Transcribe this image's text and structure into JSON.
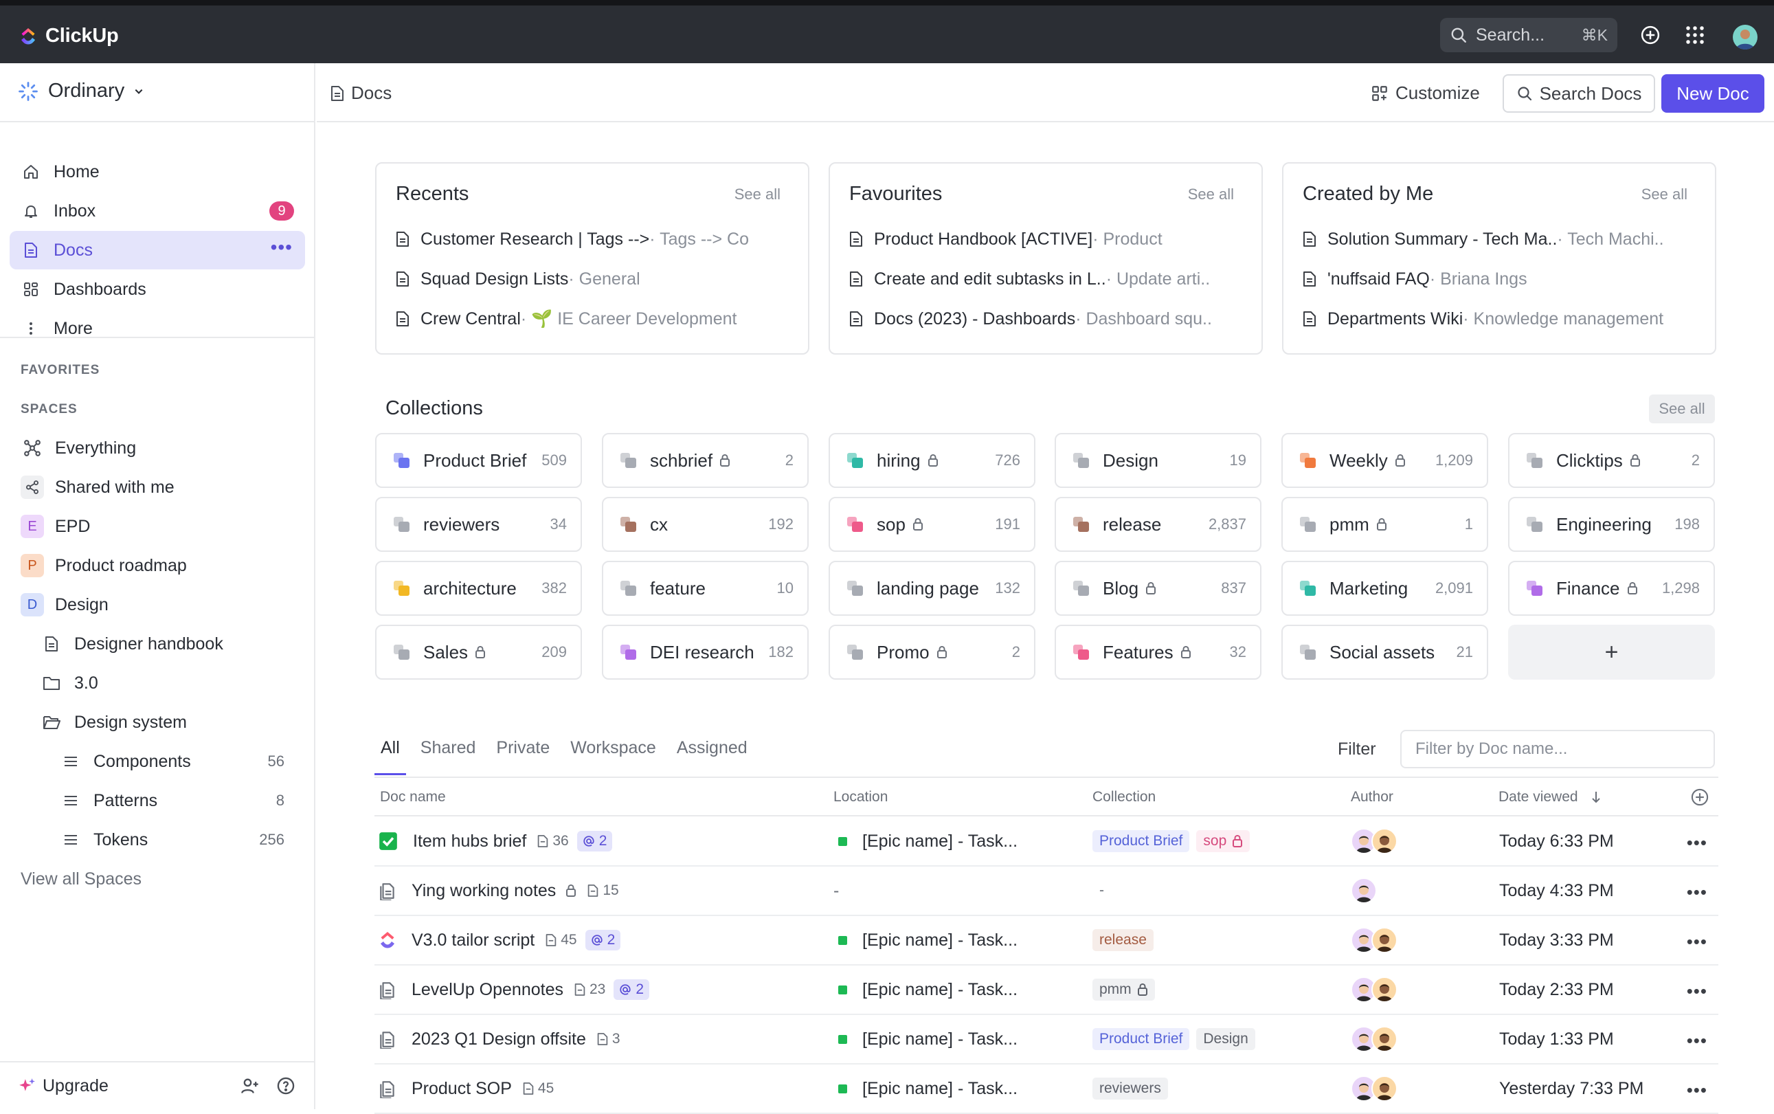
{
  "topbar": {
    "app_name": "ClickUp",
    "search_placeholder": "Search...",
    "search_shortcut": "⌘K"
  },
  "sidebar": {
    "workspace": "Ordinary",
    "nav": [
      {
        "label": "Home",
        "icon": "home-icon"
      },
      {
        "label": "Inbox",
        "icon": "bell-icon",
        "badge": "9"
      },
      {
        "label": "Docs",
        "icon": "doc-icon",
        "active": true
      },
      {
        "label": "Dashboards",
        "icon": "grid-icon"
      },
      {
        "label": "More",
        "icon": "more-vertical-icon"
      }
    ],
    "favorites_label": "FAVORITES",
    "spaces_label": "SPACES",
    "spaces": [
      {
        "label": "Everything",
        "icon": "everything-icon"
      },
      {
        "label": "Shared with me",
        "icon": "share-icon"
      },
      {
        "label": "EPD",
        "letter": "E",
        "color": "#e9d5f8",
        "fg": "#8a3fc7"
      },
      {
        "label": "Product roadmap",
        "letter": "P",
        "color": "#fbd8c2",
        "fg": "#c2531b"
      },
      {
        "label": "Design",
        "letter": "D",
        "color": "#d9e2fb",
        "fg": "#3a5bd0"
      }
    ],
    "tree": [
      {
        "label": "Designer handbook",
        "icon": "doc-icon"
      },
      {
        "label": "3.0",
        "icon": "folder-icon"
      },
      {
        "label": "Design system",
        "icon": "folder-open-icon"
      },
      {
        "label": "Components",
        "icon": "list-icon",
        "count": "56"
      },
      {
        "label": "Patterns",
        "icon": "list-icon",
        "count": "8"
      },
      {
        "label": "Tokens",
        "icon": "list-icon",
        "count": "256"
      }
    ],
    "view_all": "View all Spaces",
    "upgrade": "Upgrade"
  },
  "header": {
    "crumb": "Docs",
    "customize": "Customize",
    "search_docs": "Search Docs",
    "new_doc": "New Doc"
  },
  "cards": [
    {
      "title": "Recents",
      "see_all": "See all",
      "rows": [
        {
          "name": "Customer Research | Tags -->",
          "sub": " · Tags --> Co"
        },
        {
          "name": "Squad Design Lists",
          "sub": " · General"
        },
        {
          "name": "Crew Central",
          "sub": " · 🌱 IE Career Development"
        }
      ]
    },
    {
      "title": "Favourites",
      "see_all": "See all",
      "rows": [
        {
          "name": "Product Handbook [ACTIVE]",
          "sub": " · Product"
        },
        {
          "name": "Create and edit subtasks in L..",
          "sub": " · Update arti.."
        },
        {
          "name": "Docs (2023) - Dashboards",
          "sub": " · Dashboard squ.."
        }
      ]
    },
    {
      "title": "Created by Me",
      "see_all": "See all",
      "rows": [
        {
          "name": "Solution Summary - Tech Ma..",
          "sub": " · Tech Machi.."
        },
        {
          "name": "'nuffsaid FAQ",
          "sub": " · Briana Ings"
        },
        {
          "name": "Departments Wiki",
          "sub": " · Knowledge management"
        }
      ]
    }
  ],
  "collections": {
    "title": "Collections",
    "see_all": "See all",
    "items": [
      {
        "name": "Product Brief",
        "count": "509",
        "color": "#6b74f0",
        "lock": false
      },
      {
        "name": "schbrief",
        "count": "2",
        "color": "#a7abb3",
        "lock": true
      },
      {
        "name": "hiring",
        "count": "726",
        "color": "#2fb9a6",
        "lock": true
      },
      {
        "name": "Design",
        "count": "19",
        "color": "#a7abb3",
        "lock": false
      },
      {
        "name": "Weekly",
        "count": "1,209",
        "color": "#f07a3e",
        "lock": true
      },
      {
        "name": "Clicktips",
        "count": "2",
        "color": "#a7abb3",
        "lock": true
      },
      {
        "name": "reviewers",
        "count": "34",
        "color": "#a7abb3",
        "lock": false
      },
      {
        "name": "cx",
        "count": "192",
        "color": "#a5715f",
        "lock": false
      },
      {
        "name": "sop",
        "count": "191",
        "color": "#ee5a8a",
        "lock": true
      },
      {
        "name": "release",
        "count": "2,837",
        "color": "#a5715f",
        "lock": false
      },
      {
        "name": "pmm",
        "count": "1",
        "color": "#a7abb3",
        "lock": true
      },
      {
        "name": "Engineering",
        "count": "198",
        "color": "#a7abb3",
        "lock": false
      },
      {
        "name": "architecture",
        "count": "382",
        "color": "#f2b824",
        "lock": false
      },
      {
        "name": "feature",
        "count": "10",
        "color": "#a7abb3",
        "lock": false
      },
      {
        "name": "landing page",
        "count": "132",
        "color": "#a7abb3",
        "lock": false
      },
      {
        "name": "Blog",
        "count": "837",
        "color": "#a7abb3",
        "lock": true
      },
      {
        "name": "Marketing",
        "count": "2,091",
        "color": "#2fb9a6",
        "lock": false
      },
      {
        "name": "Finance",
        "count": "1,298",
        "color": "#b06ce8",
        "lock": true
      },
      {
        "name": "Sales",
        "count": "209",
        "color": "#a7abb3",
        "lock": true
      },
      {
        "name": "DEI research",
        "count": "182",
        "color": "#b06ce8",
        "lock": false
      },
      {
        "name": "Promo",
        "count": "2",
        "color": "#a7abb3",
        "lock": true
      },
      {
        "name": "Features",
        "count": "32",
        "color": "#ee5a8a",
        "lock": true
      },
      {
        "name": "Social assets",
        "count": "21",
        "color": "#a7abb3",
        "lock": false
      }
    ],
    "add": "+"
  },
  "tabs": [
    "All",
    "Shared",
    "Private",
    "Workspace",
    "Assigned"
  ],
  "filter": {
    "label": "Filter",
    "placeholder": "Filter by Doc name..."
  },
  "table": {
    "headers": {
      "name": "Doc name",
      "location": "Location",
      "collection": "Collection",
      "author": "Author",
      "date": "Date viewed"
    },
    "rows": [
      {
        "icon": "check",
        "name": "Item hubs brief",
        "pages": "36",
        "mentions": "2",
        "location": "[Epic name] - Task...",
        "tags": [
          {
            "t": "Product Brief",
            "bg": "#eceefd",
            "fg": "#5563d8"
          },
          {
            "t": "sop",
            "bg": "#fdeef3",
            "fg": "#d64a7d",
            "lock": true
          }
        ],
        "authors": 2,
        "date": "Today 6:33 PM"
      },
      {
        "icon": "doc",
        "name": "Ying working notes",
        "lock": true,
        "pages": "15",
        "mentions": "",
        "location": "-",
        "tags": [
          {
            "t": "-",
            "bg": "transparent",
            "fg": "#6b7079"
          }
        ],
        "authors": 1,
        "date": "Today 4:33 PM"
      },
      {
        "icon": "clickup",
        "name": "V3.0 tailor script",
        "pages": "45",
        "mentions": "2",
        "location": "[Epic name] - Task...",
        "tags": [
          {
            "t": "release",
            "bg": "#f6ede9",
            "fg": "#a35b41"
          }
        ],
        "authors": 2,
        "date": "Today 3:33 PM"
      },
      {
        "icon": "doc",
        "name": "LevelUp Opennotes",
        "pages": "23",
        "mentions": "2",
        "location": "[Epic name] - Task...",
        "tags": [
          {
            "t": "pmm",
            "bg": "#f0f1f3",
            "fg": "#5c6069",
            "lock": true
          }
        ],
        "authors": 2,
        "date": "Today 2:33 PM"
      },
      {
        "icon": "doc",
        "name": "2023 Q1 Design offsite",
        "pages": "3",
        "mentions": "",
        "location": "[Epic name] - Task...",
        "tags": [
          {
            "t": "Product Brief",
            "bg": "#eceefd",
            "fg": "#5563d8"
          },
          {
            "t": "Design",
            "bg": "#f0f1f3",
            "fg": "#5c6069"
          }
        ],
        "authors": 2,
        "date": "Today 1:33 PM"
      },
      {
        "icon": "doc",
        "name": "Product SOP",
        "pages": "45",
        "mentions": "",
        "location": "[Epic name] - Task...",
        "tags": [
          {
            "t": "reviewers",
            "bg": "#f0f1f3",
            "fg": "#5c6069"
          }
        ],
        "authors": 2,
        "date": "Yesterday 7:33 PM"
      }
    ]
  }
}
